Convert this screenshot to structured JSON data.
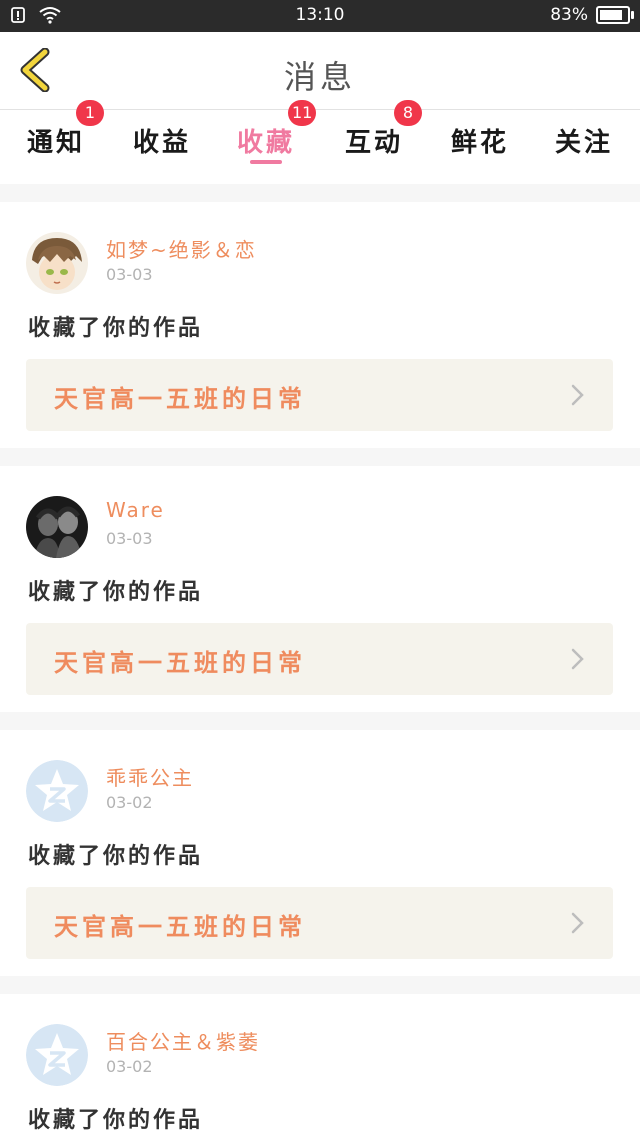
{
  "status": {
    "time": "13:10",
    "battery": "83%",
    "battery_level": 0.83
  },
  "header": {
    "title": "消息"
  },
  "tabs": [
    {
      "label": "通知",
      "badge": "1"
    },
    {
      "label": "收益",
      "badge": ""
    },
    {
      "label": "收藏",
      "badge": "11",
      "active": true
    },
    {
      "label": "互动",
      "badge": "8"
    },
    {
      "label": "鲜花",
      "badge": ""
    },
    {
      "label": "关注",
      "badge": ""
    }
  ],
  "messages": [
    {
      "user": "如梦~绝影＆恋",
      "date": "03-03",
      "action": "收藏了你的作品",
      "work": "天官高一五班的日常",
      "avatar": "anime-avatar-icon"
    },
    {
      "user": "Ware",
      "date": "03-03",
      "action": "收藏了你的作品",
      "work": "天官高一五班的日常",
      "avatar": "photo-avatar-icon"
    },
    {
      "user": "乖乖公主",
      "date": "03-02",
      "action": "收藏了你的作品",
      "work": "天官高一五班的日常",
      "avatar": "qzone-star-icon"
    },
    {
      "user": "百合公主＆紫萎",
      "date": "03-02",
      "action": "收藏了你的作品",
      "work": "",
      "avatar": "qzone-star-icon"
    }
  ],
  "colors": {
    "accent_pink": "#f07aa0",
    "orange_text": "#ee8d5e",
    "badge_red": "#f0364a",
    "back_arrow_yellow": "#f2d53c"
  }
}
